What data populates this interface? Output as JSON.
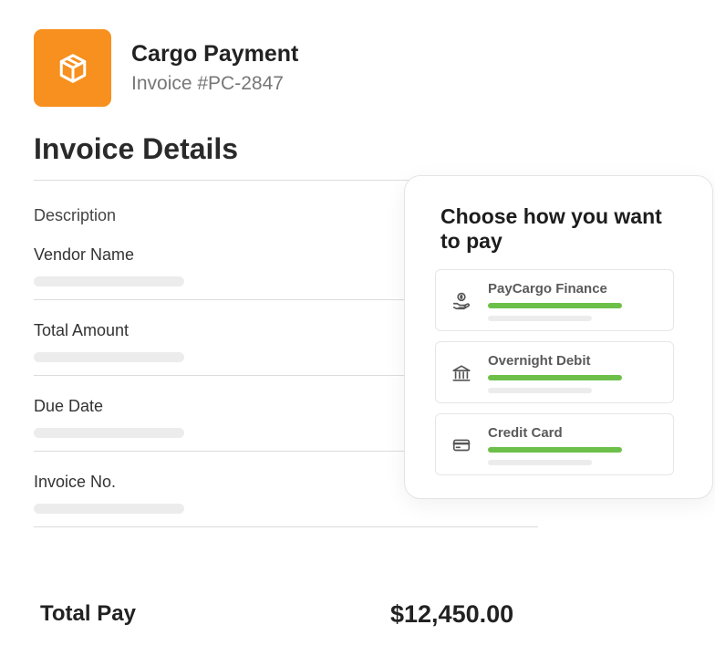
{
  "header": {
    "title": "Cargo Payment",
    "subtitle": "Invoice #PC-2847",
    "logo_icon": "box-icon",
    "logo_color": "#f7901e"
  },
  "invoice": {
    "section_title": "Invoice Details",
    "description_label": "Description",
    "fields": [
      {
        "label": "Vendor Name"
      },
      {
        "label": "Total Amount"
      },
      {
        "label": "Due Date"
      },
      {
        "label": "Invoice No."
      }
    ]
  },
  "payment": {
    "title": "Choose how you want to pay",
    "options": [
      {
        "label": "PayCargo Finance",
        "icon": "hand-coin-icon"
      },
      {
        "label": "Overnight Debit",
        "icon": "bank-icon"
      },
      {
        "label": "Credit Card",
        "icon": "credit-card-icon"
      }
    ],
    "accent_color": "#6cc04a"
  },
  "total": {
    "label": "Total Pay",
    "value": "$12,450.00"
  }
}
